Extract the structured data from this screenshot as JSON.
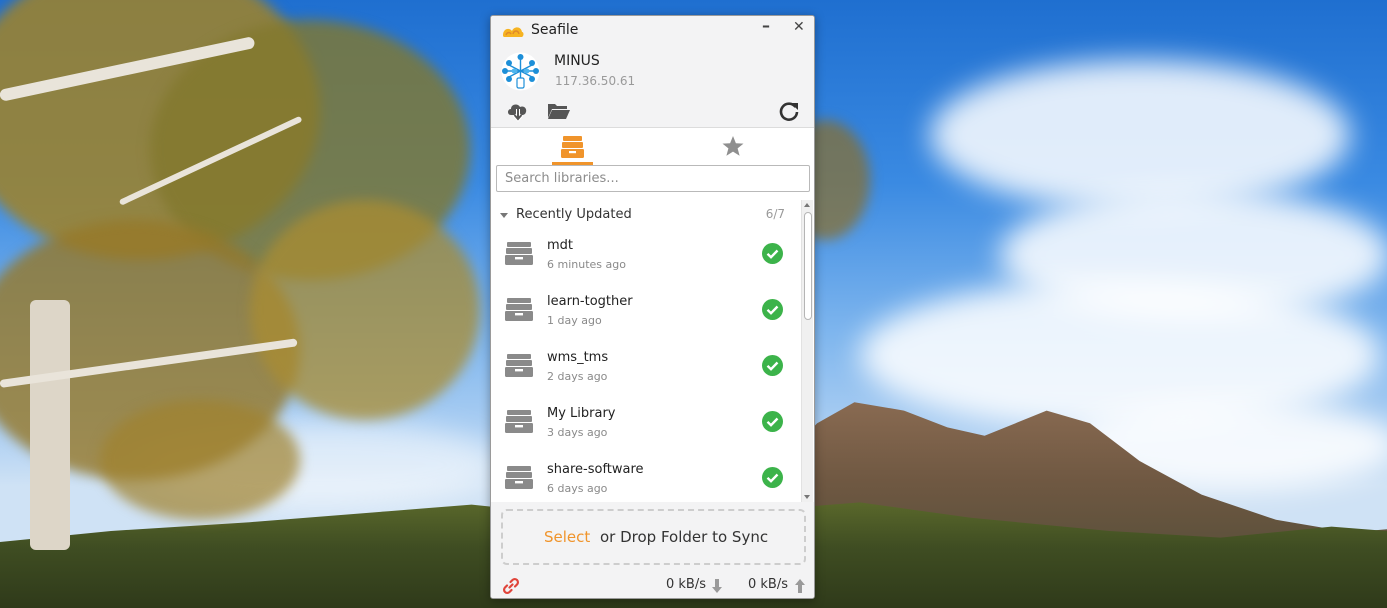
{
  "window": {
    "title": "Seafile",
    "minimize_label": "–",
    "close_label": "✕"
  },
  "account": {
    "name": "MINUS",
    "server": "117.36.50.61"
  },
  "toolbar": {
    "icons": [
      "cloud-download-icon",
      "folder-open-icon",
      "refresh-icon"
    ]
  },
  "tabs": [
    {
      "icon": "libraries-icon",
      "active": true
    },
    {
      "icon": "star-icon",
      "active": false
    }
  ],
  "search": {
    "placeholder": "Search libraries..."
  },
  "group": {
    "label": "Recently Updated",
    "count": "6/7"
  },
  "libraries": [
    {
      "name": "mdt",
      "updated": "6 minutes ago",
      "status": "synced"
    },
    {
      "name": "learn-togther",
      "updated": "1 day ago",
      "status": "synced"
    },
    {
      "name": "wms_tms",
      "updated": "2 days ago",
      "status": "synced"
    },
    {
      "name": "My Library",
      "updated": "3 days ago",
      "status": "synced"
    },
    {
      "name": "share-software",
      "updated": "6 days ago",
      "status": "synced"
    }
  ],
  "drop": {
    "select_label": "Select",
    "text": "or Drop Folder to Sync"
  },
  "status": {
    "download_rate": "0 kB/s",
    "upload_rate": "0 kB/s"
  },
  "colors": {
    "accent": "#f0942b",
    "synced": "#3cb34a",
    "link": "#e0443a"
  }
}
